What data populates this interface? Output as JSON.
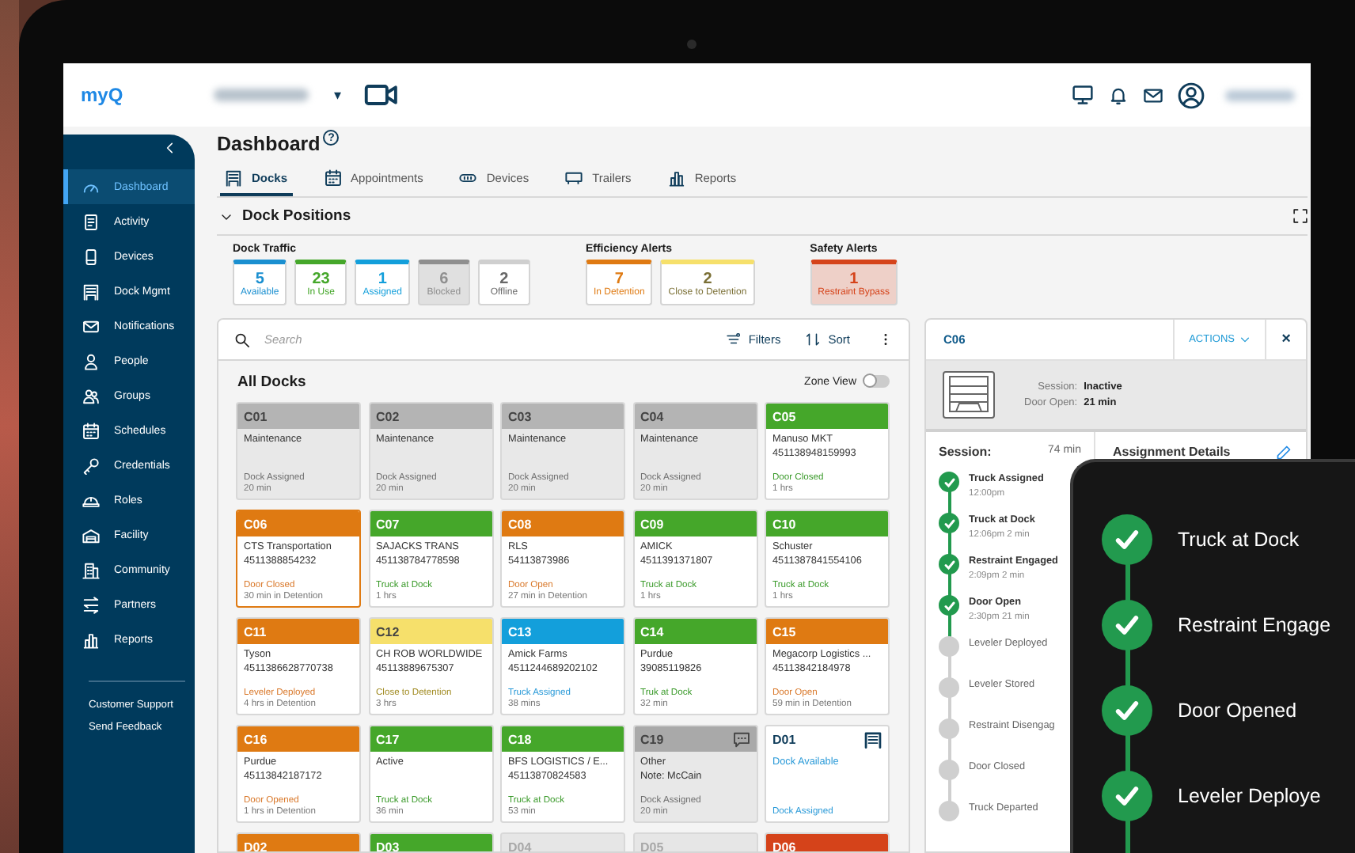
{
  "header": {
    "logo": "myQ",
    "location_caret": "▾"
  },
  "sidebar": {
    "items": [
      {
        "label": "Dashboard",
        "selected": true
      },
      {
        "label": "Activity",
        "selected": false
      },
      {
        "label": "Devices",
        "selected": false
      },
      {
        "label": "Dock Mgmt",
        "selected": false
      },
      {
        "label": "Notifications",
        "selected": false
      },
      {
        "label": "People",
        "selected": false
      },
      {
        "label": "Groups",
        "selected": false
      },
      {
        "label": "Schedules",
        "selected": false
      },
      {
        "label": "Credentials",
        "selected": false
      },
      {
        "label": "Roles",
        "selected": false
      },
      {
        "label": "Facility",
        "selected": false
      },
      {
        "label": "Community",
        "selected": false
      },
      {
        "label": "Partners",
        "selected": false
      },
      {
        "label": "Reports",
        "selected": false
      }
    ],
    "links": [
      "Customer Support",
      "Send Feedback"
    ]
  },
  "page": {
    "title": "Dashboard",
    "help": "?",
    "tabs": [
      {
        "label": "Docks",
        "selected": true
      },
      {
        "label": "Appointments",
        "selected": false
      },
      {
        "label": "Devices",
        "selected": false
      },
      {
        "label": "Trailers",
        "selected": false
      },
      {
        "label": "Reports",
        "selected": false
      }
    ]
  },
  "section": {
    "title": "Dock Positions",
    "expanded": true
  },
  "stat_groups": [
    {
      "title": "Dock Traffic",
      "stats": [
        {
          "value": "5",
          "label": "Available",
          "color": "#1a8fd0",
          "highlighted": false
        },
        {
          "value": "23",
          "label": "In Use",
          "color": "#45a72a",
          "highlighted": false
        },
        {
          "value": "1",
          "label": "Assigned",
          "color": "#139fdb",
          "highlighted": false
        },
        {
          "value": "6",
          "label": "Blocked",
          "color": "#8f8f8f",
          "highlighted": true
        },
        {
          "value": "2",
          "label": "Offline",
          "color": "#cfcfcf",
          "highlighted": false
        }
      ]
    },
    {
      "title": "Efficiency Alerts",
      "stats": [
        {
          "value": "7",
          "label": "In Detention",
          "color": "#df7a12",
          "highlighted": false
        },
        {
          "value": "2",
          "label": "Close to Detention",
          "color": "#f6e06b",
          "highlighted": false
        }
      ]
    },
    {
      "title": "Safety Alerts",
      "stats": [
        {
          "value": "1",
          "label": "Restraint Bypass",
          "color": "#d5431a",
          "highlighted": true
        }
      ]
    }
  ],
  "docks": {
    "search_placeholder": "Search",
    "filters": "Filters",
    "sort": "Sort",
    "title": "All Docks",
    "zone_view": {
      "label": "Zone View",
      "on": false
    },
    "cards": [
      {
        "id": "C01",
        "color": "#b4b4b4",
        "kind": "idle",
        "selected": false,
        "lines": [
          "Maintenance"
        ],
        "status": {
          "text": "Dock Assigned",
          "color": "#6f6f6f"
        },
        "time": "20 min"
      },
      {
        "id": "C02",
        "color": "#b4b4b4",
        "kind": "idle",
        "selected": false,
        "lines": [
          "Maintenance"
        ],
        "status": {
          "text": "Dock Assigned",
          "color": "#6f6f6f"
        },
        "time": "20 min"
      },
      {
        "id": "C03",
        "color": "#b4b4b4",
        "kind": "idle",
        "selected": false,
        "lines": [
          "Maintenance"
        ],
        "status": {
          "text": "Dock Assigned",
          "color": "#6f6f6f"
        },
        "time": "20 min"
      },
      {
        "id": "C04",
        "color": "#b4b4b4",
        "kind": "idle",
        "selected": false,
        "lines": [
          "Maintenance"
        ],
        "status": {
          "text": "Dock Assigned",
          "color": "#6f6f6f"
        },
        "time": "20 min"
      },
      {
        "id": "C05",
        "color": "#45a72a",
        "kind": "occupied",
        "selected": false,
        "lines": [
          "Manuso MKT",
          "451138948159993"
        ],
        "status": {
          "text": "Door Closed",
          "color": "#3a9a2a"
        },
        "time": "1 hrs"
      },
      {
        "id": "C06",
        "color": "#df7a12",
        "kind": "occupied",
        "selected": true,
        "lines": [
          "CTS Transportation",
          "4511388854232"
        ],
        "status": {
          "text": "Door Closed",
          "color": "#d9782a"
        },
        "time": "30 min in Detention"
      },
      {
        "id": "C07",
        "color": "#45a72a",
        "kind": "occupied",
        "selected": false,
        "lines": [
          "SAJACKS TRANS",
          "451138784778598"
        ],
        "status": {
          "text": "Truck at Dock",
          "color": "#3a9a2a"
        },
        "time": "1 hrs"
      },
      {
        "id": "C08",
        "color": "#df7a12",
        "kind": "occupied",
        "selected": false,
        "lines": [
          "RLS",
          "54113873986"
        ],
        "status": {
          "text": "Door Open",
          "color": "#d9782a"
        },
        "time": "27 min in Detention"
      },
      {
        "id": "C09",
        "color": "#45a72a",
        "kind": "occupied",
        "selected": false,
        "lines": [
          "AMICK",
          "4511391371807"
        ],
        "status": {
          "text": "Truck at Dock",
          "color": "#3a9a2a"
        },
        "time": "1 hrs"
      },
      {
        "id": "C10",
        "color": "#45a72a",
        "kind": "occupied",
        "selected": false,
        "lines": [
          "Schuster",
          "4511387841554106"
        ],
        "status": {
          "text": "Truck at Dock",
          "color": "#3a9a2a"
        },
        "time": "1 hrs"
      },
      {
        "id": "C11",
        "color": "#df7a12",
        "kind": "occupied",
        "selected": false,
        "lines": [
          "Tyson",
          "4511386628770738"
        ],
        "status": {
          "text": "Leveler Deployed",
          "color": "#d9782a"
        },
        "time": "4 hrs in Detention"
      },
      {
        "id": "C12",
        "color": "#f6e06b",
        "kind": "occupied",
        "selected": false,
        "lines": [
          "CH ROB WORLDWIDE",
          "45113889675307"
        ],
        "status": {
          "text": "Close to Detention",
          "color": "#a08a20"
        },
        "time": "3 hrs"
      },
      {
        "id": "C13",
        "color": "#139fdb",
        "kind": "occupied",
        "selected": false,
        "lines": [
          "Amick Farms",
          "4511244689202102"
        ],
        "status": {
          "text": "Truck Assigned",
          "color": "#2a9ad8"
        },
        "time": "38 mins"
      },
      {
        "id": "C14",
        "color": "#45a72a",
        "kind": "occupied",
        "selected": false,
        "lines": [
          "Purdue",
          "39085119826"
        ],
        "status": {
          "text": "Truk at Dock",
          "color": "#3a9a2a"
        },
        "time": "32 min"
      },
      {
        "id": "C15",
        "color": "#df7a12",
        "kind": "occupied",
        "selected": false,
        "lines": [
          "Megacorp Logistics ...",
          "45113842184978"
        ],
        "status": {
          "text": "Door Open",
          "color": "#d9782a"
        },
        "time": "59 min in Detention"
      },
      {
        "id": "C16",
        "color": "#df7a12",
        "kind": "occupied",
        "selected": false,
        "lines": [
          "Purdue",
          "45113842187172"
        ],
        "status": {
          "text": "Door Opened",
          "color": "#d9782a"
        },
        "time": "1 hrs in Detention"
      },
      {
        "id": "C17",
        "color": "#45a72a",
        "kind": "occupied",
        "selected": false,
        "lines": [
          "Active"
        ],
        "status": {
          "text": "Truck at Dock",
          "color": "#3a9a2a"
        },
        "time": "36 min"
      },
      {
        "id": "C18",
        "color": "#45a72a",
        "kind": "occupied",
        "selected": false,
        "lines": [
          "BFS LOGISTICS / E...",
          "45113870824583"
        ],
        "status": {
          "text": "Truck at Dock",
          "color": "#3a9a2a"
        },
        "time": "53 min"
      },
      {
        "id": "C19",
        "color": "#a9a9a9",
        "kind": "idle",
        "selected": false,
        "noted": true,
        "lines": [
          "Other",
          "Note: McCain"
        ],
        "status": {
          "text": "Dock Assigned",
          "color": "#6f6f6f"
        },
        "time": "20 min"
      },
      {
        "id": "D01",
        "color": "#ffffff",
        "kind": "open",
        "selected": false,
        "lines": [
          "Dock Available"
        ],
        "status": {
          "text": "Dock Assigned",
          "color": "#2a9ad8"
        }
      },
      {
        "id": "D02",
        "color": "#df7a12",
        "kind": "occupied",
        "selected": false
      },
      {
        "id": "D03",
        "color": "#45a72a",
        "kind": "occupied",
        "selected": false
      },
      {
        "id": "D04",
        "color": "#e6e6e6",
        "kind": "offline",
        "selected": false
      },
      {
        "id": "D05",
        "color": "#e6e6e6",
        "kind": "offline",
        "selected": false
      },
      {
        "id": "D06",
        "color": "#d5431a",
        "kind": "occupied",
        "selected": false
      }
    ]
  },
  "detail": {
    "title": "C06",
    "actions": "ACTIONS",
    "close": "×",
    "facts": [
      {
        "label": "Session:",
        "value": "Inactive"
      },
      {
        "label": "Door Open:",
        "value": "21 min"
      }
    ],
    "session_title": "Session:",
    "session_time": "74 min",
    "assignment_title": "Assignment Details",
    "steps": [
      {
        "name": "Truck Assigned",
        "time": "12:00pm",
        "done": true
      },
      {
        "name": "Truck at Dock",
        "time": "12:06pm 2 min",
        "done": true
      },
      {
        "name": "Restraint Engaged",
        "time": "2:09pm 2 min",
        "done": true
      },
      {
        "name": "Door Open",
        "time": "2:30pm 21 min",
        "done": true
      },
      {
        "name": "Leveler Deployed",
        "done": false
      },
      {
        "name": "Leveler Stored",
        "done": false
      },
      {
        "name": "Restraint Disengag",
        "done": false
      },
      {
        "name": "Door Closed",
        "done": false
      },
      {
        "name": "Truck Departed",
        "done": false
      }
    ]
  },
  "phone": {
    "steps": [
      {
        "name": "Truck at Dock",
        "done": true
      },
      {
        "name": "Restraint Engage",
        "done": true
      },
      {
        "name": "Door Opened",
        "done": true
      },
      {
        "name": "Leveler Deploye",
        "done": true
      }
    ]
  }
}
